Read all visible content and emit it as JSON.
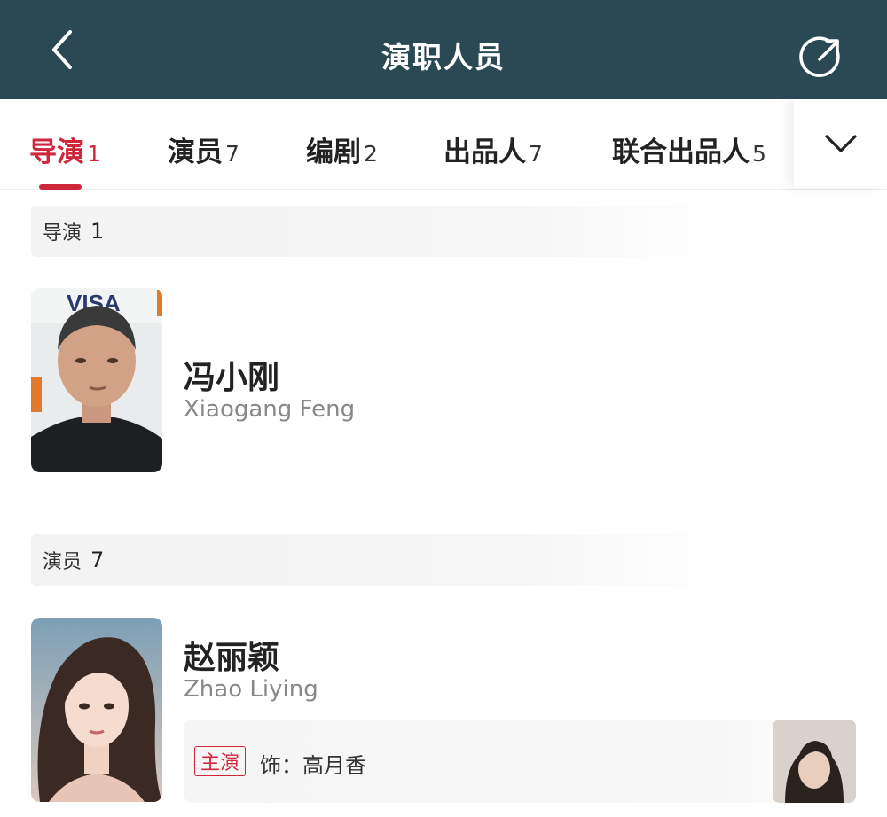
{
  "header": {
    "title": "演职人员"
  },
  "tabs": [
    {
      "label": "导演",
      "count": "1"
    },
    {
      "label": "演员",
      "count": "7"
    },
    {
      "label": "编剧",
      "count": "2"
    },
    {
      "label": "出品人",
      "count": "7"
    },
    {
      "label": "联合出品人",
      "count": "5"
    }
  ],
  "active_tab": "导演",
  "sections": [
    {
      "title": "导演",
      "count": "1",
      "people": [
        {
          "name": "冯小刚",
          "name_en": "Xiaogang Feng",
          "photo_watermark": "VISA"
        }
      ]
    },
    {
      "title": "演员",
      "count": "7",
      "people": [
        {
          "name": "赵丽颖",
          "name_en": "Zhao Liying",
          "role_badge": "主演",
          "role": "饰：高月香"
        }
      ]
    }
  ],
  "colors": {
    "header_bg": "#2b4955",
    "accent": "#d0263b"
  },
  "icons": {
    "back": "chevron-left-icon",
    "share": "share-icon",
    "expand": "chevron-down-icon"
  }
}
